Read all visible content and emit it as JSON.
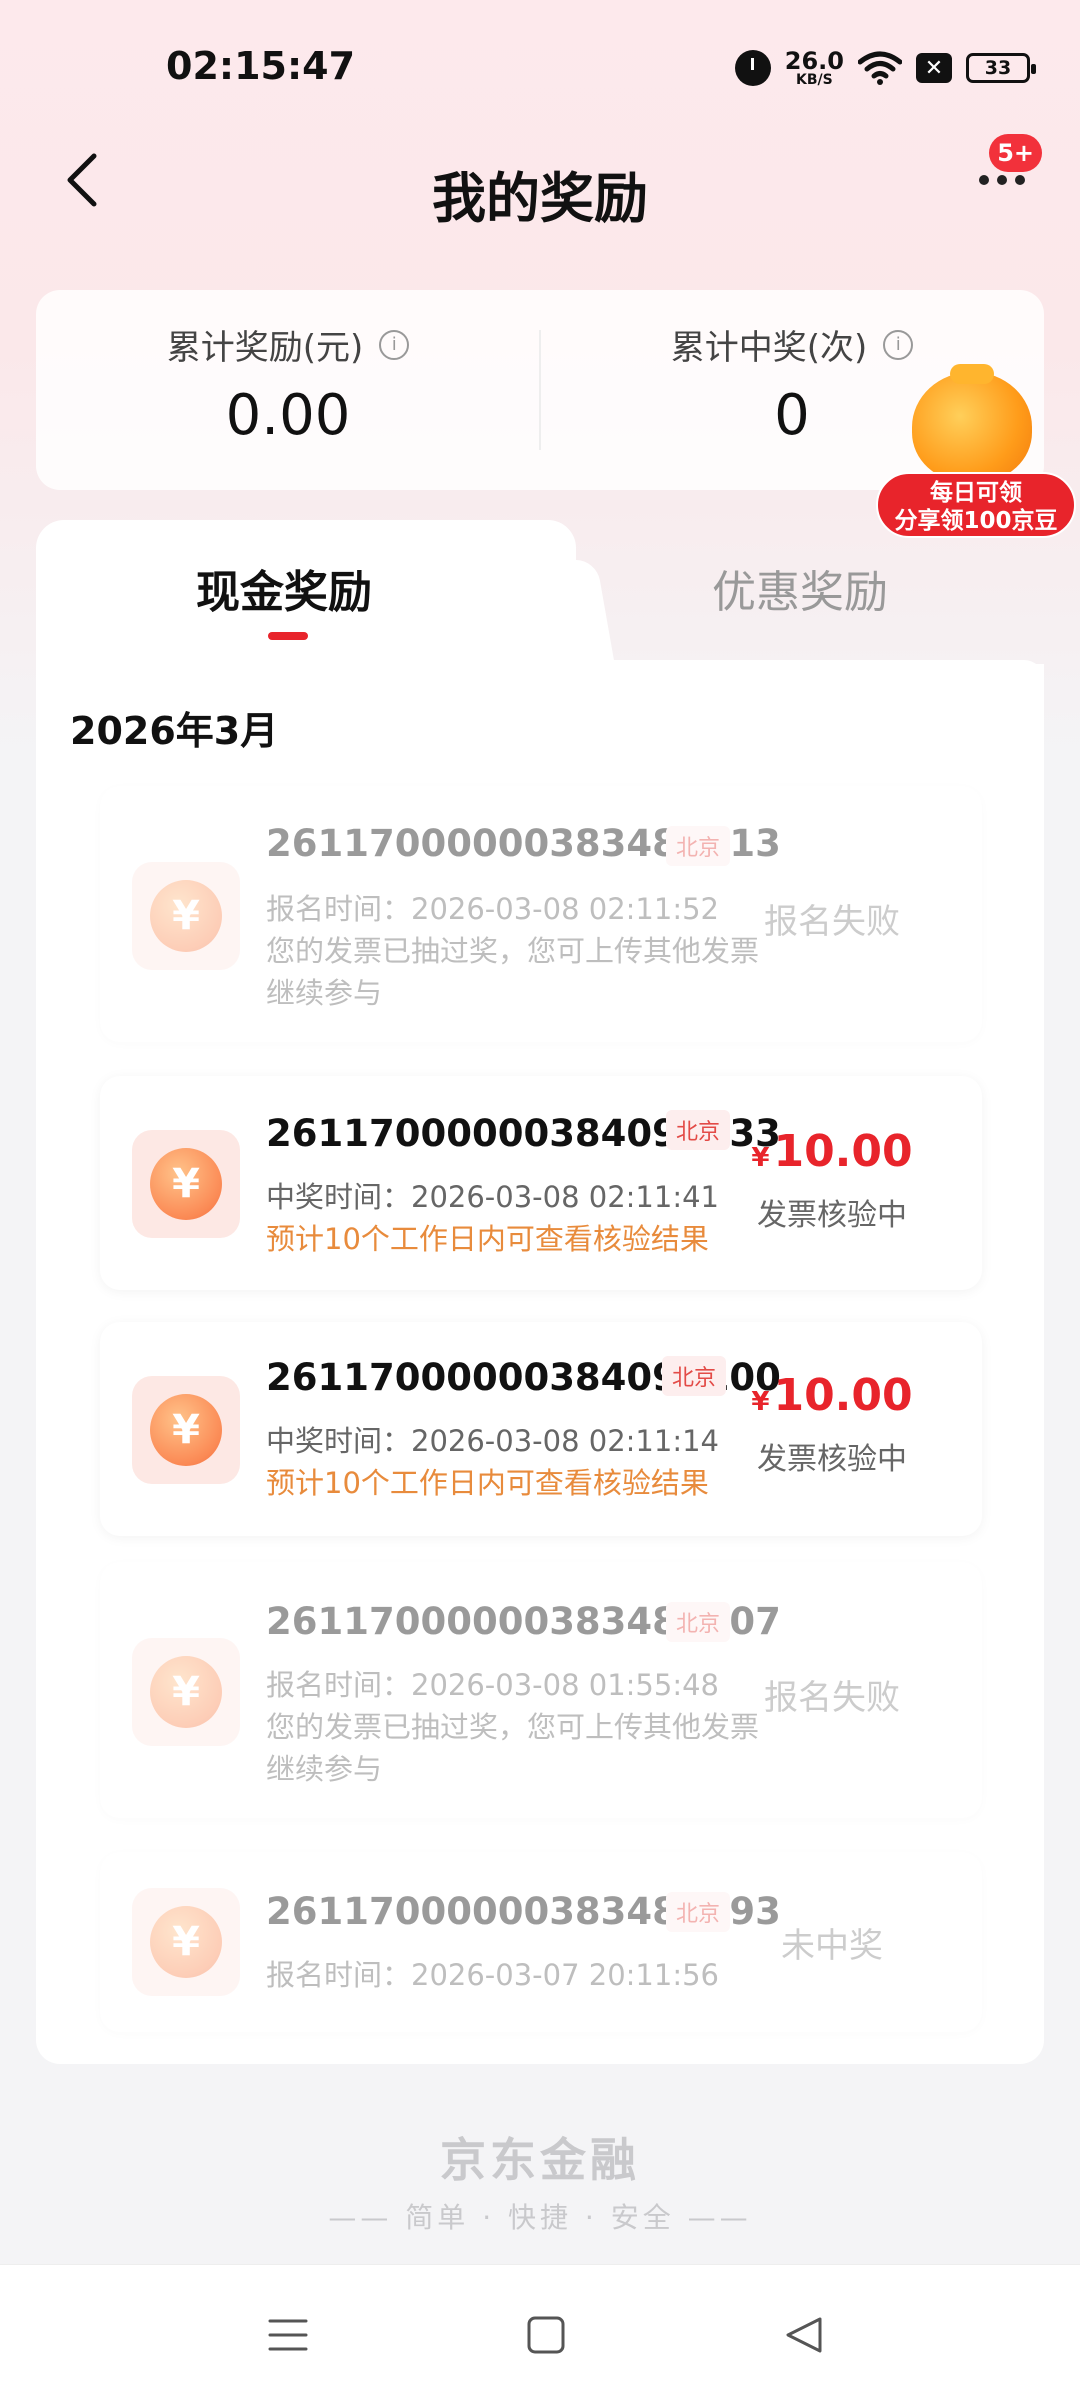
{
  "status_bar": {
    "time": "02:15:47",
    "net_speed": "26.0",
    "net_unit": "KB/S",
    "battery": "33"
  },
  "nav": {
    "title": "我的奖励",
    "badge": "5+"
  },
  "summary": {
    "reward_label": "累计奖励(元)",
    "reward_value": "0.00",
    "count_label": "累计中奖(次)",
    "count_value": "0"
  },
  "promo": {
    "line1": "每日可领",
    "line2": "分享领100京豆"
  },
  "tabs": [
    {
      "label": "现金奖励"
    },
    {
      "label": "优惠奖励"
    }
  ],
  "month": "2026年3月",
  "records": [
    {
      "invoice": "26117000000383489213",
      "loc": "北京",
      "line1": "报名时间：2026-03-08 02:11:52",
      "line2": "您的发票已抽过奖，您可上传其他发票",
      "line3": "继续参与",
      "status": "报名失败"
    },
    {
      "invoice": "26117000000384096633",
      "loc": "北京",
      "line1": "中奖时间：2026-03-08 02:11:41",
      "hint": "预计10个工作日内可查看核验结果",
      "currency": "¥",
      "amount": "10.00",
      "status": "发票核验中"
    },
    {
      "invoice": "26117000000384097100",
      "loc": "北京",
      "line1": "中奖时间：2026-03-08 02:11:14",
      "hint": "预计10个工作日内可查看核验结果",
      "currency": "¥",
      "amount": "10.00",
      "status": "发票核验中"
    },
    {
      "invoice": "26117000000383489707",
      "loc": "北京",
      "line1": "报名时间：2026-03-08 01:55:48",
      "line2": "您的发票已抽过奖，您可上传其他发票",
      "line3": "继续参与",
      "status": "报名失败"
    },
    {
      "invoice": "26117000000383488693",
      "loc": "北京",
      "line1": "报名时间：2026-03-07 20:11:56",
      "status": "未中奖"
    }
  ],
  "footer": {
    "brand": "京东金融",
    "tagline": "—— 简单 · 快捷 · 安全 ——"
  },
  "icons": {
    "coin": "¥"
  },
  "colors": {
    "accent": "#e8242b",
    "hint": "#e88b3c"
  }
}
